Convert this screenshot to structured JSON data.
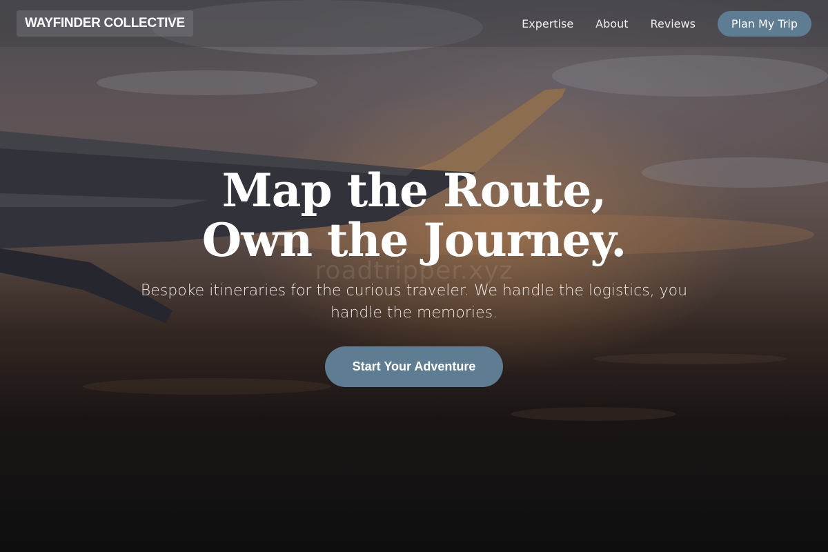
{
  "brand": {
    "name": "WAYFINDER COLLECTIVE"
  },
  "nav": {
    "links": [
      "Expertise",
      "About",
      "Reviews"
    ],
    "cta_label": "Plan My Trip"
  },
  "hero": {
    "headline_line1": "Map the Route,",
    "headline_line2": "Own the Journey.",
    "subtitle": "Bespoke itineraries for the curious traveler. We handle the logistics, you handle the memories.",
    "cta_label": "Start Your Adventure",
    "watermark": "roadtripper.xyz"
  },
  "colors": {
    "accent": "#5e7d93",
    "text": "#ffffff"
  }
}
